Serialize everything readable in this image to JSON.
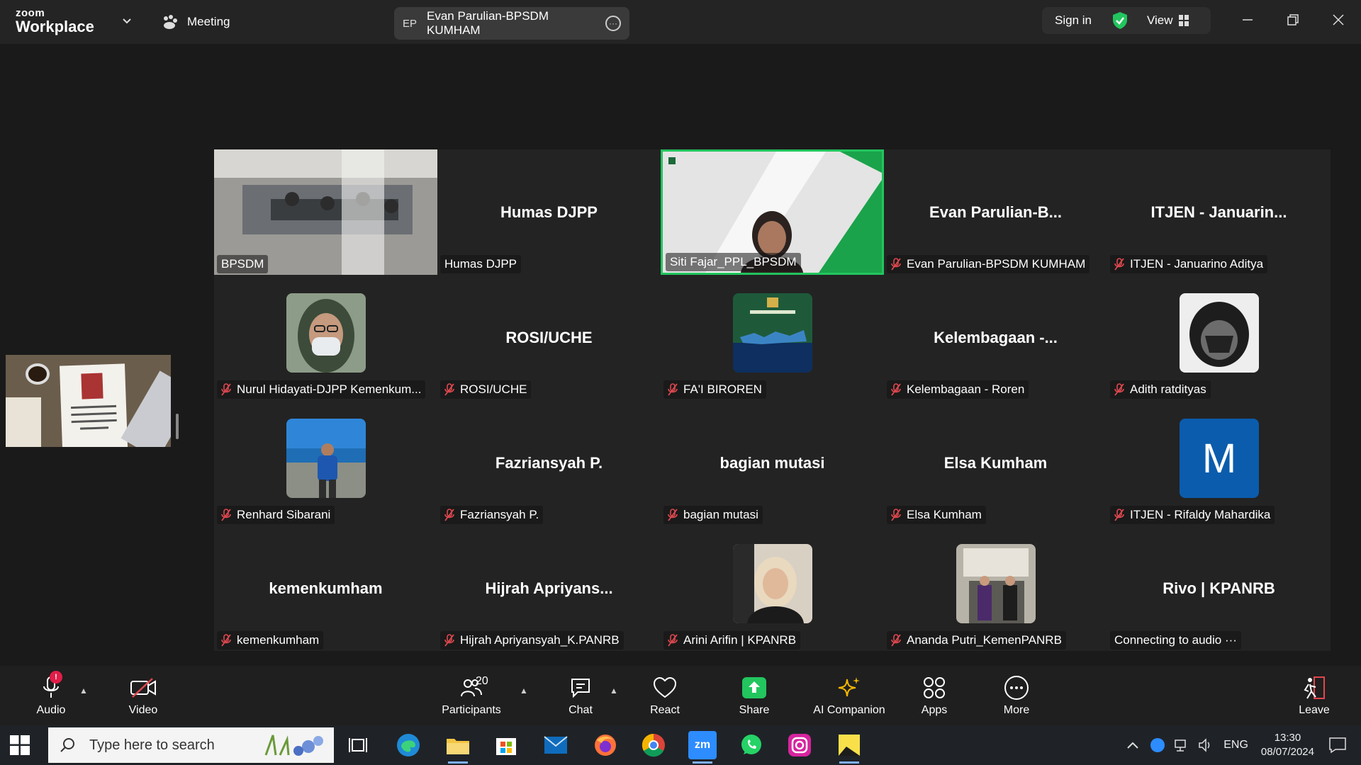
{
  "titlebar": {
    "logo_top": "zoom",
    "logo_bottom": "Workplace",
    "meeting_label": "Meeting",
    "host_initials": "EP",
    "host_name": "Evan Parulian-BPSDM KUMHAM",
    "sign_in": "Sign in",
    "view": "View"
  },
  "tiles": [
    {
      "label": "BPSDM",
      "big": "",
      "muted": false,
      "video": "room"
    },
    {
      "label": "Humas DJPP",
      "big": "Humas DJPP",
      "muted": false
    },
    {
      "label": "Siti Fajar_PPL_BPSDM",
      "big": "",
      "muted": false,
      "video": "person",
      "active": true
    },
    {
      "label": "Evan Parulian-BPSDM KUMHAM",
      "big": "Evan Parulian-B...",
      "muted": true
    },
    {
      "label": "ITJEN - Januarino Aditya",
      "big": "ITJEN - Januarin...",
      "muted": true
    },
    {
      "label": "Nurul Hidayati-DJPP Kemenkum...",
      "big": "",
      "muted": true,
      "avatar": "hijab-mask"
    },
    {
      "label": "ROSI/UCHE",
      "big": "ROSI/UCHE",
      "muted": true
    },
    {
      "label": "FA'I BIROREN",
      "big": "",
      "muted": true,
      "avatar": "map"
    },
    {
      "label": "Kelembagaan - Roren",
      "big": "Kelembagaan -...",
      "muted": true
    },
    {
      "label": "Adith ratdityas",
      "big": "",
      "muted": true,
      "avatar": "helmet"
    },
    {
      "label": "Renhard Sibarani",
      "big": "",
      "muted": true,
      "avatar": "beach"
    },
    {
      "label": "Fazriansyah P.",
      "big": "Fazriansyah P.",
      "muted": true
    },
    {
      "label": "bagian mutasi",
      "big": "bagian mutasi",
      "muted": true
    },
    {
      "label": "Elsa Kumham",
      "big": "Elsa Kumham",
      "muted": true
    },
    {
      "label": "ITJEN - Rifaldy Mahardika",
      "big": "",
      "muted": true,
      "avatar": "letter",
      "letter": "M"
    },
    {
      "label": "kemenkumham",
      "big": "kemenkumham",
      "muted": true
    },
    {
      "label": "Hijrah Apriyansyah_K.PANRB",
      "big": "Hijrah Apriyans...",
      "muted": true
    },
    {
      "label": "Arini Arifin | KPANRB",
      "big": "",
      "muted": true,
      "avatar": "hijab"
    },
    {
      "label": "Ananda Putri_KemenPANRB",
      "big": "",
      "muted": true,
      "avatar": "graduation"
    },
    {
      "label": "Connecting to audio ···",
      "big": "Rivo | KPANRB",
      "muted": false
    }
  ],
  "toolbar": {
    "audio": "Audio",
    "audio_badge": "!",
    "video": "Video",
    "participants": "Participants",
    "participants_count": "20",
    "chat": "Chat",
    "react": "React",
    "share": "Share",
    "ai_companion": "AI Companion",
    "apps": "Apps",
    "more": "More",
    "leave": "Leave"
  },
  "taskbar": {
    "search_placeholder": "Type here to search",
    "zoom_icon_text": "zm",
    "language": "ENG",
    "time": "13:30",
    "date": "08/07/2024"
  },
  "colors": {
    "active_speaker": "#22c55e",
    "muted": "#e0484f",
    "share": "#22c55e",
    "letter_avatar": "#0b5cad"
  }
}
